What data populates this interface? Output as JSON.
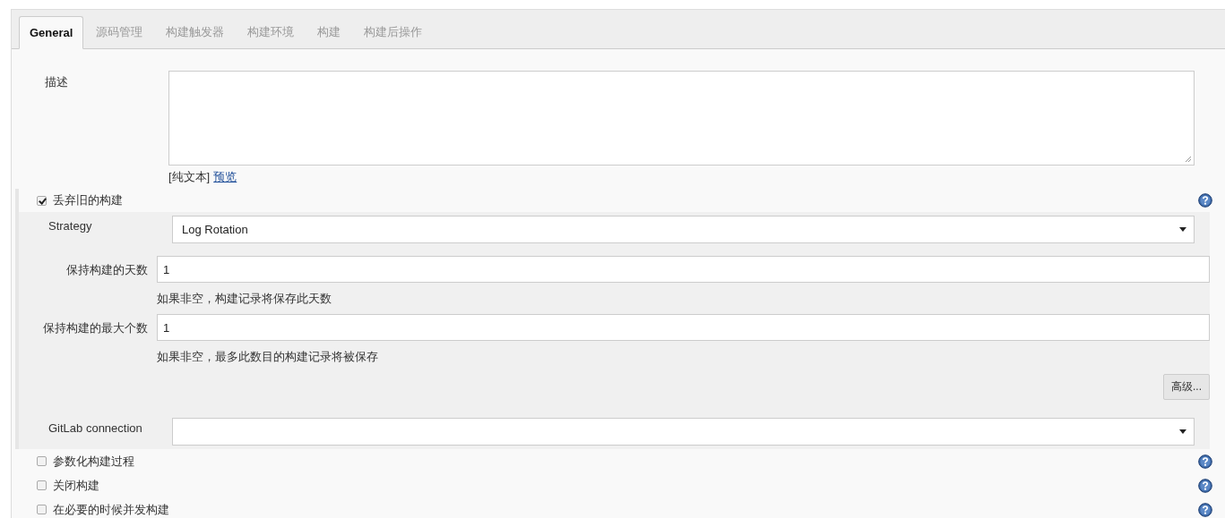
{
  "tabs": [
    {
      "label": "General",
      "selected": true
    },
    {
      "label": "源码管理",
      "selected": false
    },
    {
      "label": "构建触发器",
      "selected": false
    },
    {
      "label": "构建环境",
      "selected": false
    },
    {
      "label": "构建",
      "selected": false
    },
    {
      "label": "构建后操作",
      "selected": false
    }
  ],
  "description": {
    "label": "描述",
    "format_note": "[纯文本]",
    "preview_link": "预览"
  },
  "discard_old_builds": {
    "label": "丢弃旧的构建",
    "checked": true,
    "strategy": {
      "label": "Strategy",
      "value": "Log Rotation"
    },
    "fields": [
      {
        "label": "保持构建的天数",
        "value": "1",
        "help": "如果非空，构建记录将保存此天数"
      },
      {
        "label": "保持构建的最大个数",
        "value": "1",
        "help": "如果非空，最多此数目的构建记录将被保存"
      }
    ],
    "advanced_button": "高级..."
  },
  "gitlab_connection": {
    "label": "GitLab connection"
  },
  "options": [
    {
      "label": "参数化构建过程",
      "checked": false
    },
    {
      "label": "关闭构建",
      "checked": false
    },
    {
      "label": "在必要的时候并发构建",
      "checked": false
    }
  ]
}
